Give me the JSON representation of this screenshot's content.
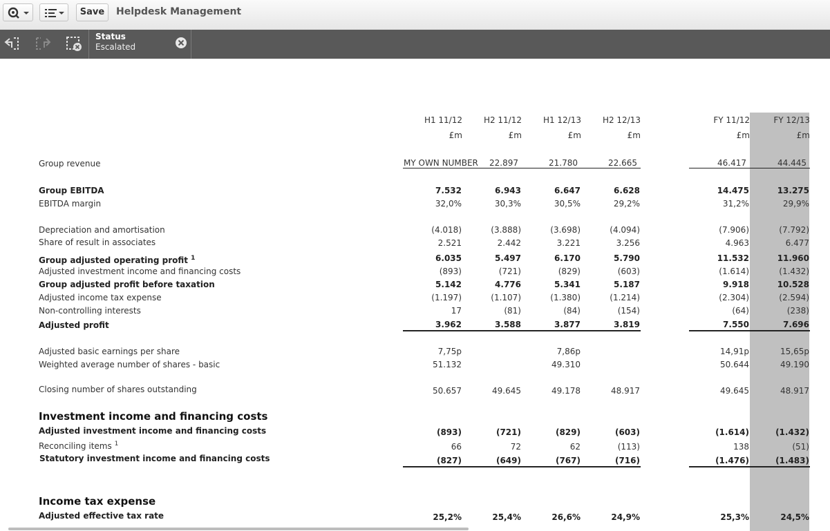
{
  "toolbar": {
    "save_label": "Save",
    "app_title": "Helpdesk Management"
  },
  "selection": {
    "field": "Status",
    "value": "Escalated"
  },
  "columns": [
    {
      "period": "H1 11/12",
      "unit": "£m"
    },
    {
      "period": "H2 11/12",
      "unit": "£m"
    },
    {
      "period": "H1 12/13",
      "unit": "£m"
    },
    {
      "period": "H2 12/13",
      "unit": "£m"
    },
    {
      "period": "FY 11/12",
      "unit": "£m"
    },
    {
      "period": "FY 12/13",
      "unit": "£m"
    }
  ],
  "rows": {
    "group_revenue": {
      "label": "Group revenue",
      "values": [
        "MY OWN NUMBER",
        "22.897",
        "21.780",
        "22.665",
        "46.417",
        "44.445"
      ]
    },
    "group_ebitda": {
      "label": "Group EBITDA",
      "values": [
        "7.532",
        "6.943",
        "6.647",
        "6.628",
        "14.475",
        "13.275"
      ]
    },
    "ebitda_margin": {
      "label": "EBITDA margin",
      "values": [
        "32,0%",
        "30,3%",
        "30,5%",
        "29,2%",
        "31,2%",
        "29,9%"
      ]
    },
    "depreciation": {
      "label": "Depreciation and amortisation",
      "values": [
        "(4.018)",
        "(3.888)",
        "(3.698)",
        "(4.094)",
        "(7.906)",
        "(7.792)"
      ]
    },
    "share_associates": {
      "label": "Share of result in associates",
      "values": [
        "2.521",
        "2.442",
        "3.221",
        "3.256",
        "4.963",
        "6.477"
      ]
    },
    "adj_operating_profit": {
      "label": "Group adjusted operating profit",
      "sup": "1",
      "values": [
        "6.035",
        "5.497",
        "6.170",
        "5.790",
        "11.532",
        "11.960"
      ]
    },
    "adj_investment_income": {
      "label": "Adjusted investment income and financing costs",
      "values": [
        "(893)",
        "(721)",
        "(829)",
        "(603)",
        "(1.614)",
        "(1.432)"
      ]
    },
    "adj_profit_before_tax": {
      "label": "Group adjusted profit before taxation",
      "values": [
        "5.142",
        "4.776",
        "5.341",
        "5.187",
        "9.918",
        "10.528"
      ]
    },
    "adj_income_tax": {
      "label": "Adjusted income tax expense",
      "values": [
        "(1.197)",
        "(1.107)",
        "(1.380)",
        "(1.214)",
        "(2.304)",
        "(2.594)"
      ]
    },
    "non_controlling": {
      "label": "Non-controlling interests",
      "values": [
        "17",
        "(81)",
        "(84)",
        "(154)",
        "(64)",
        "(238)"
      ]
    },
    "adjusted_profit": {
      "label": "Adjusted profit",
      "values": [
        "3.962",
        "3.588",
        "3.877",
        "3.819",
        "7.550",
        "7.696"
      ]
    },
    "adj_basic_eps": {
      "label": "Adjusted basic earnings per share",
      "values": [
        "7,75p",
        "",
        "7,86p",
        "",
        "14,91p",
        "15,65p"
      ]
    },
    "weighted_avg_shares": {
      "label": "Weighted average number of shares - basic",
      "values": [
        "51.132",
        "",
        "49.310",
        "",
        "50.644",
        "49.190"
      ]
    },
    "closing_shares": {
      "label": "Closing number of shares outstanding",
      "values": [
        "50.657",
        "49.645",
        "49.178",
        "48.917",
        "49.645",
        "48.917"
      ]
    },
    "sec_investment_title": {
      "label": "Investment income and financing costs"
    },
    "adj_investment_income_2": {
      "label": "Adjusted investment income and financing costs",
      "values": [
        "(893)",
        "(721)",
        "(829)",
        "(603)",
        "(1.614)",
        "(1.432)"
      ]
    },
    "reconciling_items": {
      "label": "Reconciling items",
      "sup": "1",
      "values": [
        "66",
        "72",
        "62",
        "(113)",
        "138",
        "(51)"
      ]
    },
    "statutory_investment": {
      "label": "Statutory investment income and financing costs",
      "values": [
        "(827)",
        "(649)",
        "(767)",
        "(716)",
        "(1.476)",
        "(1.483)"
      ]
    },
    "sec_tax_title": {
      "label": "Income tax expense"
    },
    "adj_effective_tax": {
      "label": "Adjusted effective tax rate",
      "values": [
        "25,2%",
        "25,4%",
        "26,6%",
        "24,9%",
        "25,3%",
        "24,5%"
      ]
    }
  },
  "colors": {
    "toolbar_bg": "#ececec",
    "selection_bar": "#595959",
    "highlight_column": "#c0c0c0"
  }
}
